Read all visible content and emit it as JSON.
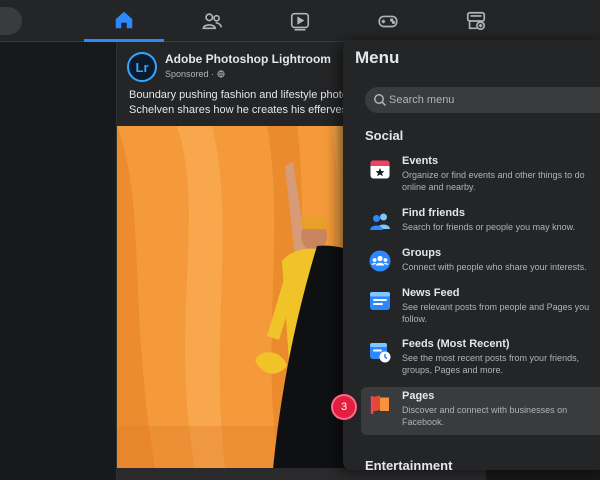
{
  "post": {
    "page_name": "Adobe Photoshop Lightroom",
    "logo_text": "Lr",
    "sponsored": "Sponsored · ",
    "text_line1": "Boundary pushing fashion and lifestyle photo",
    "text_line2": "Schelven shares how he creates his effervesc"
  },
  "menu": {
    "title": "Menu",
    "search_placeholder": "Search menu",
    "section_title": "Social",
    "items": [
      {
        "label": "Events",
        "desc": "Organize or find events and other things to do online and nearby."
      },
      {
        "label": "Find friends",
        "desc": "Search for friends or people you may know."
      },
      {
        "label": "Groups",
        "desc": "Connect with people who share your interests."
      },
      {
        "label": "News Feed",
        "desc": "See relevant posts from people and Pages you follow."
      },
      {
        "label": "Feeds (Most Recent)",
        "desc": "See the most recent posts from your friends, groups, Pages and more."
      },
      {
        "label": "Pages",
        "desc": "Discover and connect with businesses on Facebook."
      }
    ],
    "next_section": "Entertainment"
  },
  "badge": "3",
  "colors": {
    "accent": "#2d88ff",
    "panel": "#242526",
    "background": "#18191a",
    "badge": "#e41e3f"
  },
  "icons": [
    "home-icon",
    "friends-icon",
    "watch-icon",
    "gaming-icon",
    "marketplace-icon",
    "search-icon",
    "events-icon",
    "find-friends-icon",
    "groups-icon",
    "news-feed-icon",
    "most-recent-icon",
    "pages-icon",
    "globe-icon"
  ]
}
